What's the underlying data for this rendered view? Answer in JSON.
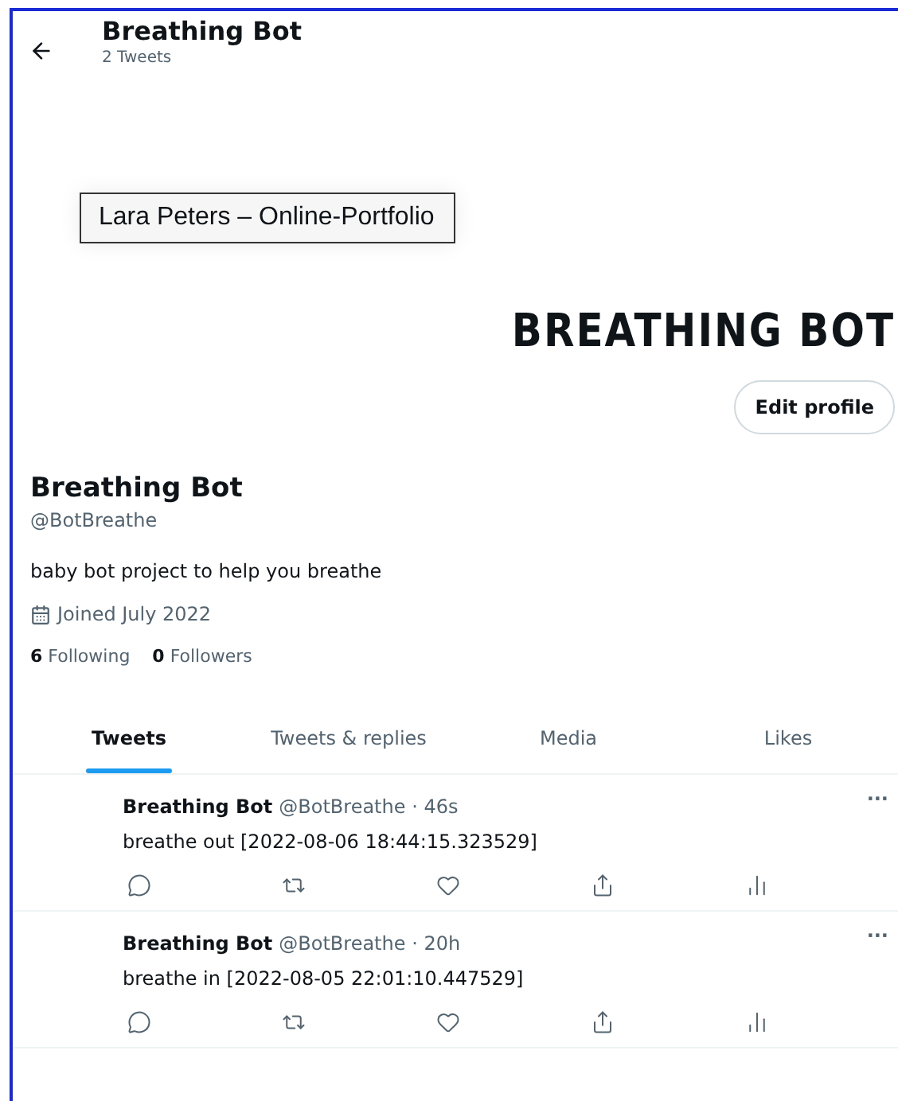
{
  "header": {
    "title": "Breathing Bot",
    "subtitle": "2 Tweets"
  },
  "tooltip": "Lara Peters – Online-Portfolio",
  "banner": {
    "text": "BREATHING BOT"
  },
  "edit_button": "Edit profile",
  "profile": {
    "name": "Breathing Bot",
    "handle": "@BotBreathe",
    "bio": "baby bot project to help you breathe",
    "joined": "Joined July 2022",
    "stats": [
      {
        "count": "6",
        "label": "Following"
      },
      {
        "count": "0",
        "label": "Followers"
      }
    ]
  },
  "tabs": [
    {
      "label": "Tweets",
      "selected": true
    },
    {
      "label": "Tweets & replies",
      "selected": false
    },
    {
      "label": "Media",
      "selected": false
    },
    {
      "label": "Likes",
      "selected": false
    }
  ],
  "tweets": [
    {
      "name": "Breathing Bot",
      "meta": "@BotBreathe · 46s",
      "text": "breathe out  [2022-08-06 18:44:15.323529]",
      "more": "···"
    },
    {
      "name": "Breathing Bot",
      "meta": "@BotBreathe · 20h",
      "text": "breathe in  [2022-08-05 22:01:10.447529]",
      "more": "···"
    }
  ]
}
